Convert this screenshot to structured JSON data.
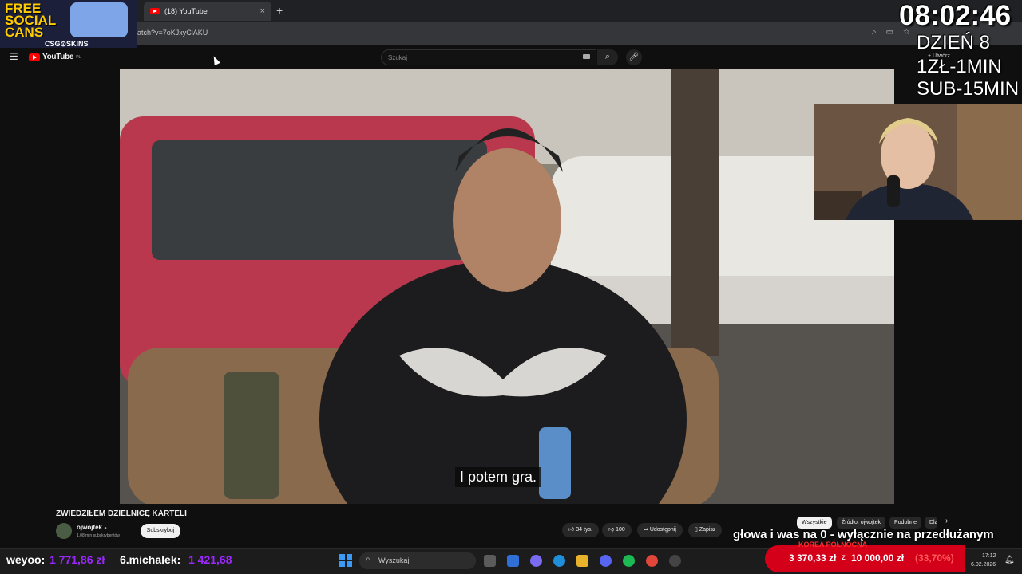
{
  "browser": {
    "tab_title": "(18) YouTube",
    "tab_close": "×",
    "new_tab": "+",
    "url": "atch?v=7oKJxyCiAKU"
  },
  "youtube": {
    "logo_text": "YouTube",
    "logo_region": "PL",
    "search_placeholder": "Szukaj",
    "create_label": "Utwórz",
    "video": {
      "subtitle": "I potem gra.",
      "title": "ZWIEDZIŁEM DZIELNICĘ KARTELI",
      "channel_name": "ojwojtek",
      "subscribers": "1,08 mln subskrybentów",
      "subscribe_label": "Subskrybuj",
      "likes": "34 tys.",
      "dislikes": "100",
      "share_label": "Udostępnij",
      "save_label": "Zapisz"
    },
    "chips": [
      "Wszystkie",
      "Źródło: ojwojtek",
      "Podobne",
      "Dla"
    ]
  },
  "stream": {
    "promo_text_line1": "FREE",
    "promo_text_line2": "SOCIAL",
    "promo_text_line3": "CANS",
    "promo_brand": "CSG⊙SKINS",
    "clock": "08:02:46",
    "day_label": "DZIEŃ 8",
    "rate_1": "1ZŁ-1MIN",
    "rate_2": "SUB-15MIN",
    "ticker": "głowa i was na 0 - wyłącznie na przedłużanym",
    "leaderboard": [
      {
        "name": "weyoo:",
        "amount": "1 771,86 zł"
      },
      {
        "name": "6.michalek:",
        "amount": "1 421,68"
      }
    ],
    "goal": {
      "label": "KOREA PÓŁNOCNA",
      "current": "3 370,33 zł",
      "of": "z",
      "target": "10 000,00 zł",
      "percent": "(33,70%)",
      "progress": 0.337,
      "color": "#d4001a"
    }
  },
  "taskbar": {
    "search_placeholder": "Wyszukaj",
    "time": "17:12",
    "date": "6.02.2026"
  }
}
